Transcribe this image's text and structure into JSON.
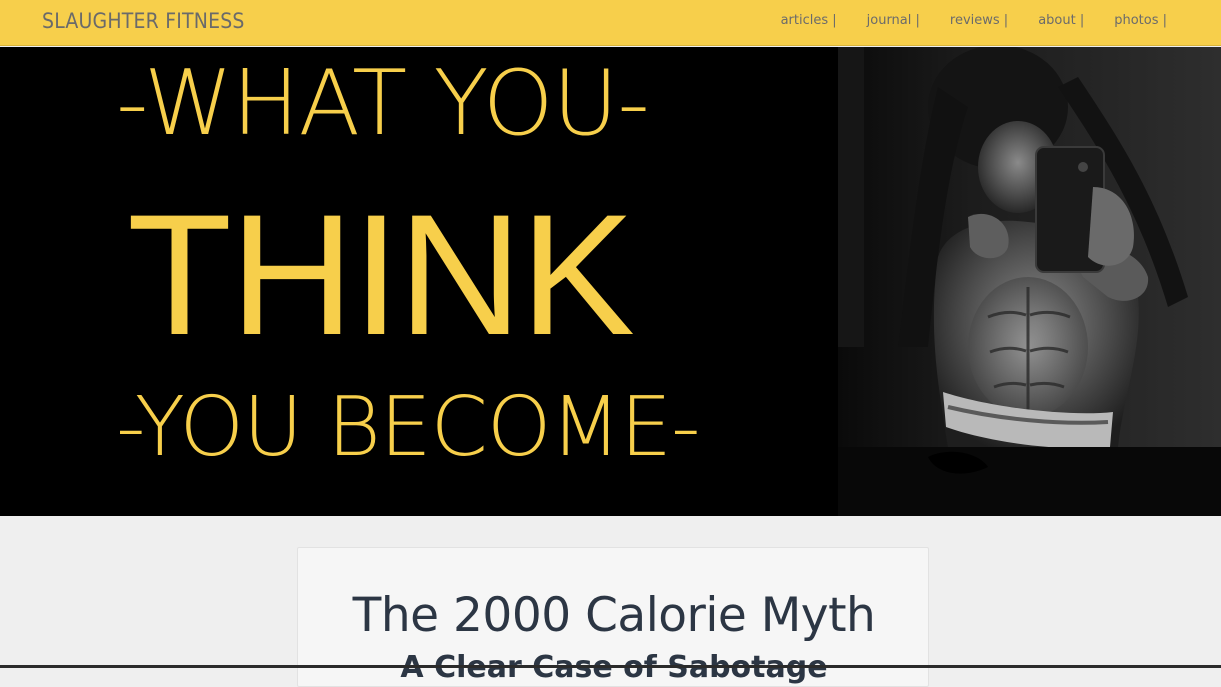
{
  "navbar": {
    "brand": "SLAUGHTER FITNESS",
    "items": [
      {
        "label": "articles |"
      },
      {
        "label": "journal |"
      },
      {
        "label": "reviews |"
      },
      {
        "label": "about |"
      },
      {
        "label": "photos |"
      }
    ],
    "bg_color": "#f7cf4b"
  },
  "hero": {
    "line1": "-WHAT YOU-",
    "line2": "THINK",
    "line3": "-YOU BECOME-",
    "text_color": "#f7cf4b",
    "photo_icon": "fitness-selfie-photo"
  },
  "post": {
    "title": "The 2000 Calorie Myth",
    "subtitle": "A Clear Case of Sabotage"
  }
}
